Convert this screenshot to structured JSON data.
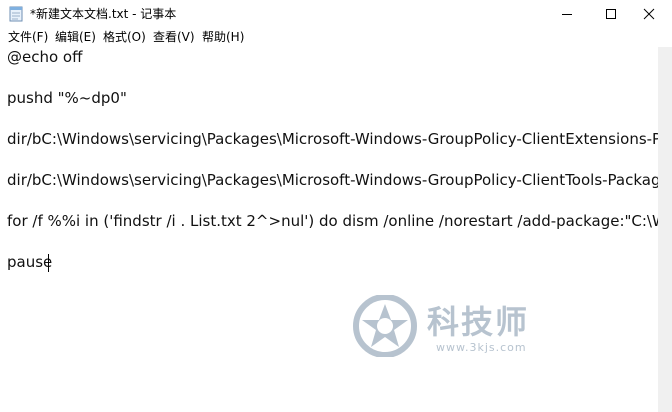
{
  "window": {
    "title": "*新建文本文档.txt - 记事本",
    "minimize_glyph": "—",
    "maximize_glyph": "☐",
    "close_glyph": "✕"
  },
  "menu": {
    "items": [
      {
        "label": "文件(F)"
      },
      {
        "label": "编辑(E)"
      },
      {
        "label": "格式(O)"
      },
      {
        "label": "查看(V)"
      },
      {
        "label": "帮助(H)"
      }
    ]
  },
  "document": {
    "lines": [
      "@echo off",
      "pushd \"%~dp0\"",
      "dir/bC:\\Windows\\servicing\\Packages\\Microsoft-Windows-GroupPolicy-ClientExtensions-Package",
      "dir/bC:\\Windows\\servicing\\Packages\\Microsoft-Windows-GroupPolicy-ClientTools-Package",
      "for /f %%i in ('findstr /i . List.txt 2^>nul') do dism /online /norestart /add-package:\"C:\\Windows",
      "pause"
    ]
  },
  "watermark": {
    "title": "科技师",
    "url": "www.3kjs.com"
  }
}
